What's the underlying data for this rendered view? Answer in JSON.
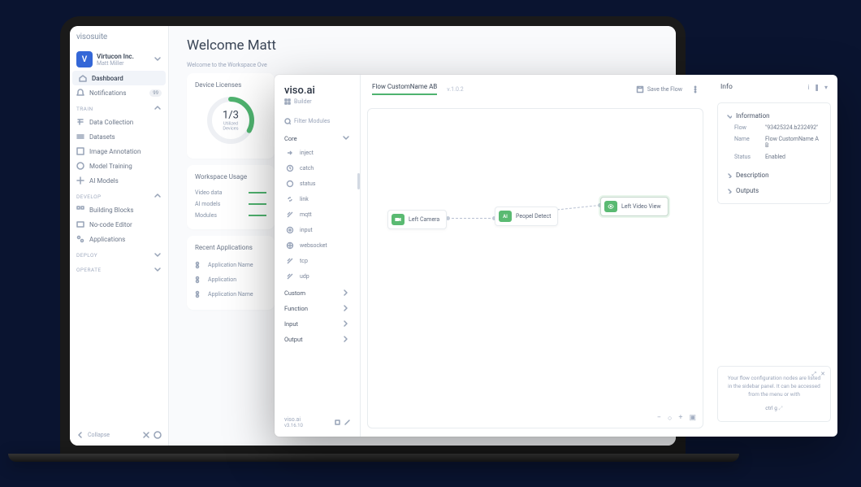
{
  "suite": {
    "logo": "visosuite",
    "org": {
      "avatar": "V",
      "name": "Virtucon Inc.",
      "sub": "Matt Miller"
    },
    "nav": {
      "dashboard": "Dashboard",
      "notifications": "Notifications",
      "notif_badge": "99",
      "sections": {
        "train": {
          "label": "TRAIN",
          "items": [
            "Data Collection",
            "Datasets",
            "Image Annotation",
            "Model Training",
            "AI Models"
          ]
        },
        "develop": {
          "label": "DEVELOP",
          "items": [
            "Building Blocks",
            "No-code Editor",
            "Applications"
          ]
        },
        "deploy": {
          "label": "DEPLOY"
        },
        "operate": {
          "label": "OPERATE"
        }
      }
    },
    "collapse": "Collapse"
  },
  "dash": {
    "welcome": "Welcome Matt",
    "subtitle": "Welcome to the Workspace Ove",
    "licenses": {
      "title": "Device Licenses",
      "value": "1/3",
      "label": "Utilized\nDevices"
    },
    "usage": {
      "title": "Workspace Usage",
      "rows": [
        "Video data",
        "AI models",
        "Modules"
      ]
    },
    "recent": {
      "title": "Recent Applications",
      "rows": [
        "Application Name",
        "Application",
        "Application Name"
      ]
    }
  },
  "builder": {
    "brand": "viso.ai",
    "brand_sub": "Builder",
    "filter_placeholder": "Filter Modules",
    "groups": {
      "core": {
        "label": "Core",
        "items": [
          "inject",
          "catch",
          "status",
          "link",
          "mqtt",
          "input",
          "websocket",
          "tcp",
          "udp"
        ]
      },
      "custom": "Custom",
      "function": "Function",
      "input": "Input",
      "output": "Output"
    },
    "footer_brand": "viso.ai",
    "footer_ver": "v3.16.10",
    "flow_tab": "Flow CustomName AB",
    "flow_ver": "v.1.0.2",
    "save": "Save the Flow",
    "nodes": {
      "left": "Left Camera",
      "mid": "Peopel Detect",
      "right": "Left Video View"
    },
    "info": {
      "title": "Info",
      "section_info": "Information",
      "flow_k": "Flow",
      "flow_v": "\"93425324.b232492\"",
      "name_k": "Name",
      "name_v": "Flow CustomName AB",
      "status_k": "Status",
      "status_v": "Enabled",
      "desc": "Description",
      "outputs": "Outputs"
    },
    "hint": {
      "text": "Your flow configuration nodes are listed in the sidebar panel. It can be accessed from the menu or with",
      "key": "ctrl g"
    }
  }
}
